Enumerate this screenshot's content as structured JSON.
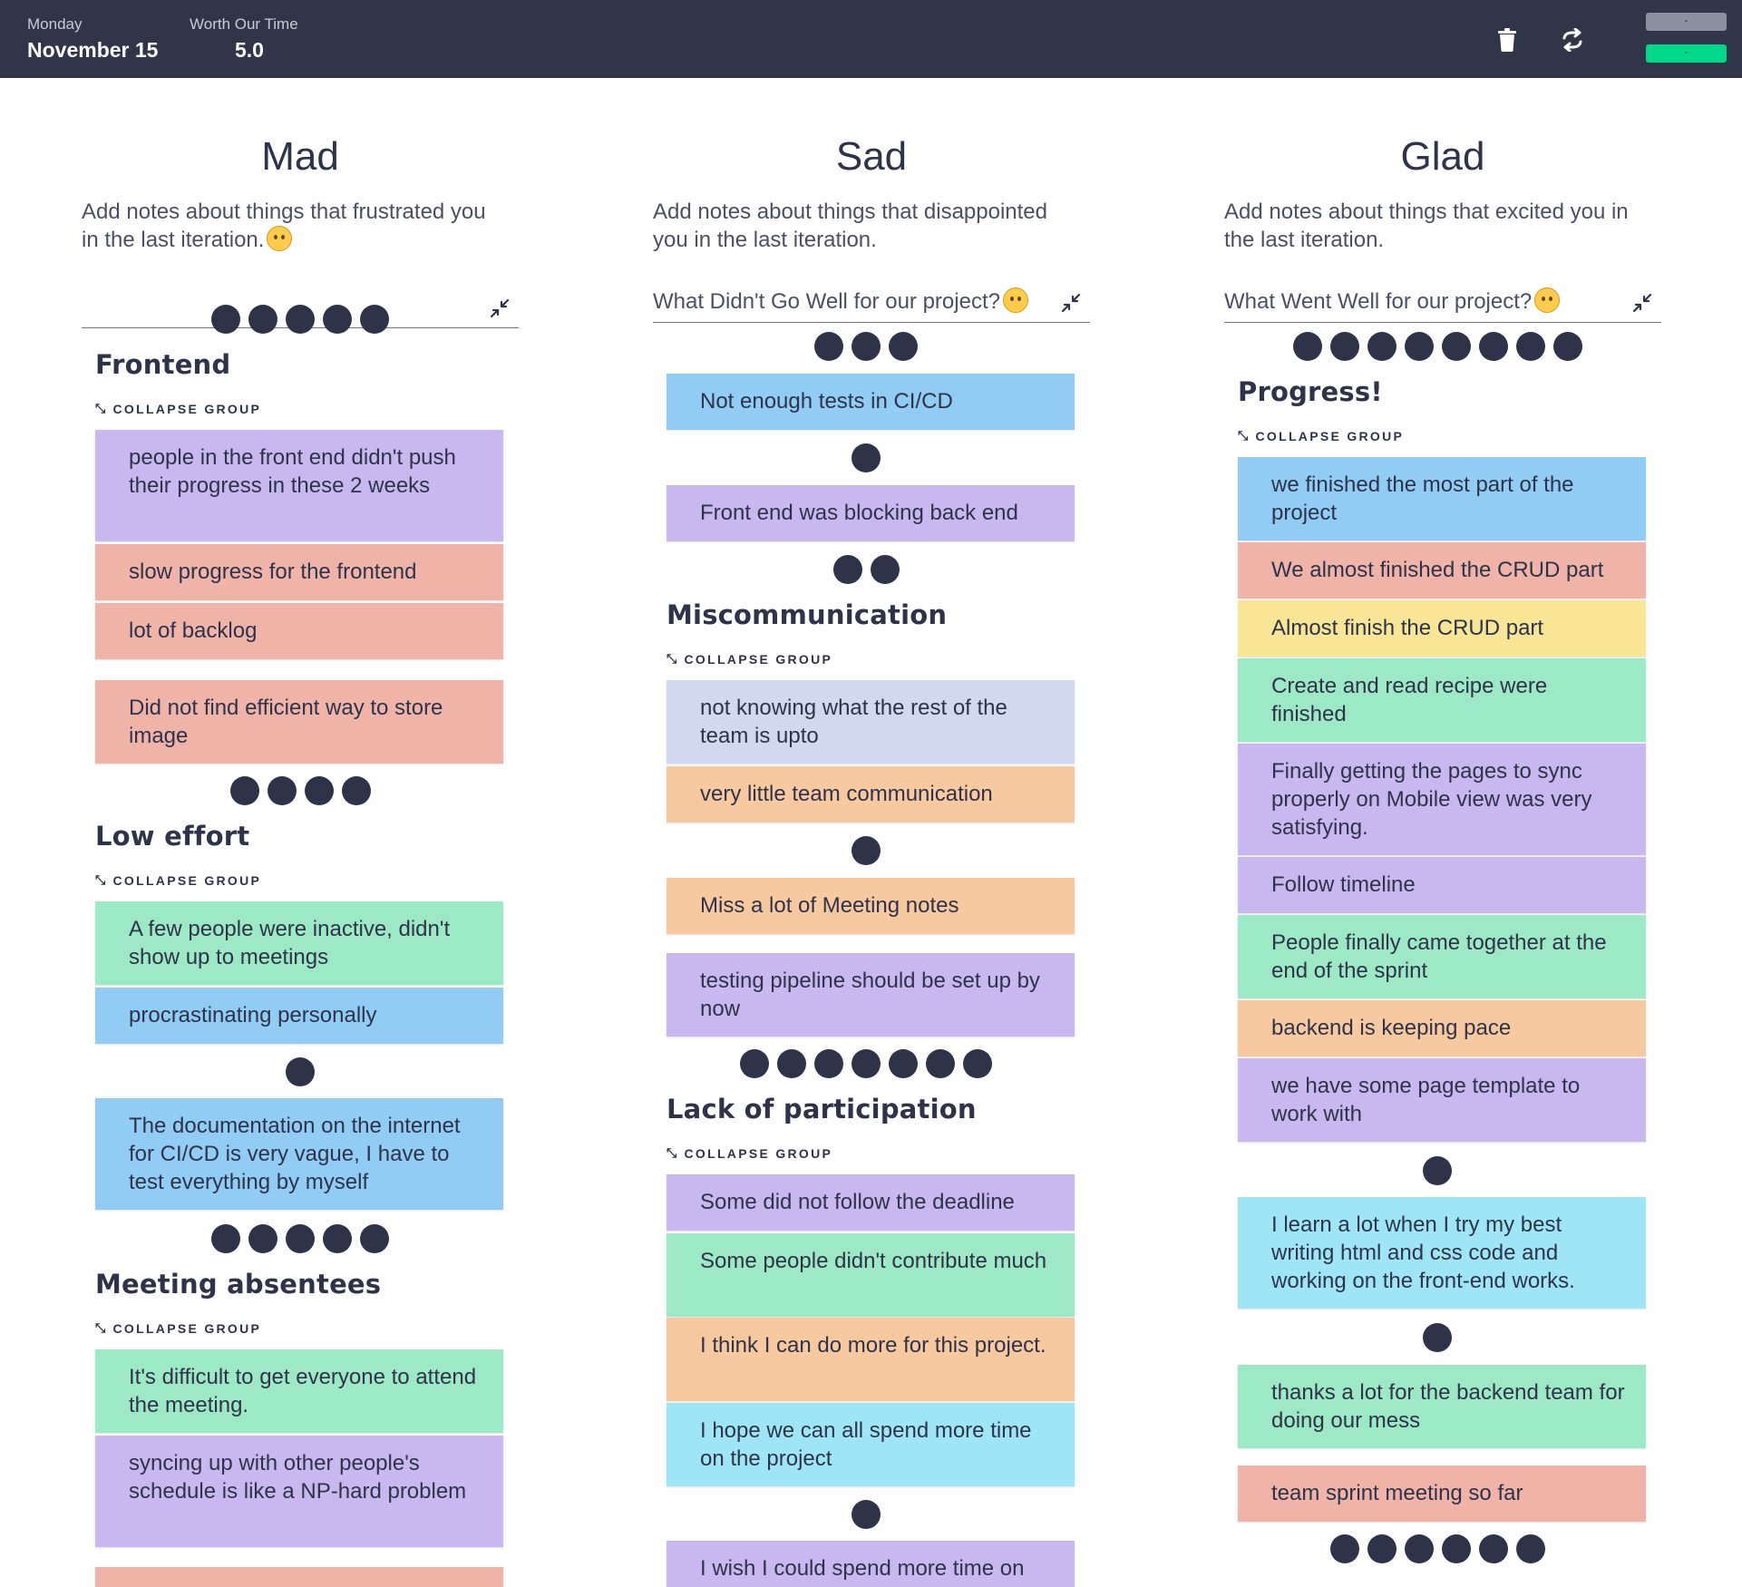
{
  "header": {
    "day_label": "Monday",
    "date": "November 15",
    "worth_label": "Worth Our Time",
    "worth_value": "5.0",
    "buttons": {
      "top_label": "-",
      "bottom_label": "-"
    },
    "colors": {
      "bar": "#303549",
      "top_button": "#8a90a0",
      "bottom_button": "#00d88a"
    }
  },
  "columns": [
    {
      "title": "Mad",
      "description": "Add notes about things that frustrated you in the last iteration.",
      "input_value": "",
      "emoji": "frustrated-face"
    },
    {
      "title": "Sad",
      "description": "Add notes about things that disappointed you in the last iteration.",
      "input_value": "What Didn't Go Well for our project?",
      "emoji": "worried-face"
    },
    {
      "title": "Glad",
      "description": "Add notes about things that excited you in the last iteration.",
      "input_value": "What Went Well for our project?",
      "emoji": "grinning-face"
    }
  ],
  "collapse_label": "COLLAPSE GROUP",
  "vote_counts": {
    "mad": [
      5,
      4,
      1,
      5
    ],
    "sad": [
      3,
      1,
      2,
      1,
      7,
      1
    ],
    "glad": [
      8,
      1,
      1,
      6
    ]
  },
  "mad": {
    "groups": [
      "Frontend",
      "Low effort",
      "Meeting absentees"
    ],
    "notes": [
      "people in the front end didn't push their progress in these 2 weeks",
      "slow progress for the frontend",
      "lot of backlog",
      "Did not find efficient way to store image",
      "A few people were inactive, didn't show up to meetings",
      "procrastinating personally",
      "The documentation on the internet for CI/CD is very vague, I have to test everything by myself",
      "It's difficult to get everyone to attend the meeting.",
      "syncing up with other people's schedule is like a NP-hard problem"
    ]
  },
  "sad": {
    "groups": [
      "Miscommunication",
      "Lack of participation"
    ],
    "notes": [
      "Not enough tests in CI/CD",
      "Front end was blocking back end",
      "not knowing what the rest of the team is upto",
      "very little team communication",
      "Miss a lot of Meeting notes",
      "testing pipeline should be set up by now",
      "Some did not follow the deadline",
      "Some people didn't contribute much",
      "I think I can do more for this project.",
      "I hope we can all spend more time on the project",
      "I wish I could spend more time on"
    ]
  },
  "glad": {
    "groups": [
      "Progress!"
    ],
    "notes": [
      "we finished the most part of the project",
      "We almost finished the CRUD part",
      "Almost finish the CRUD part",
      "Create and read recipe were finished",
      "Finally getting the pages to sync properly on Mobile view was very satisfying.",
      "Follow timeline",
      "People finally came together at the end of the sprint",
      "backend is keeping pace",
      "we have some page template to work with",
      "I learn a lot when I try my best writing html and css code and working on the front-end works.",
      "thanks a lot for the backend team for doing our mess",
      "team sprint meeting so far"
    ]
  }
}
